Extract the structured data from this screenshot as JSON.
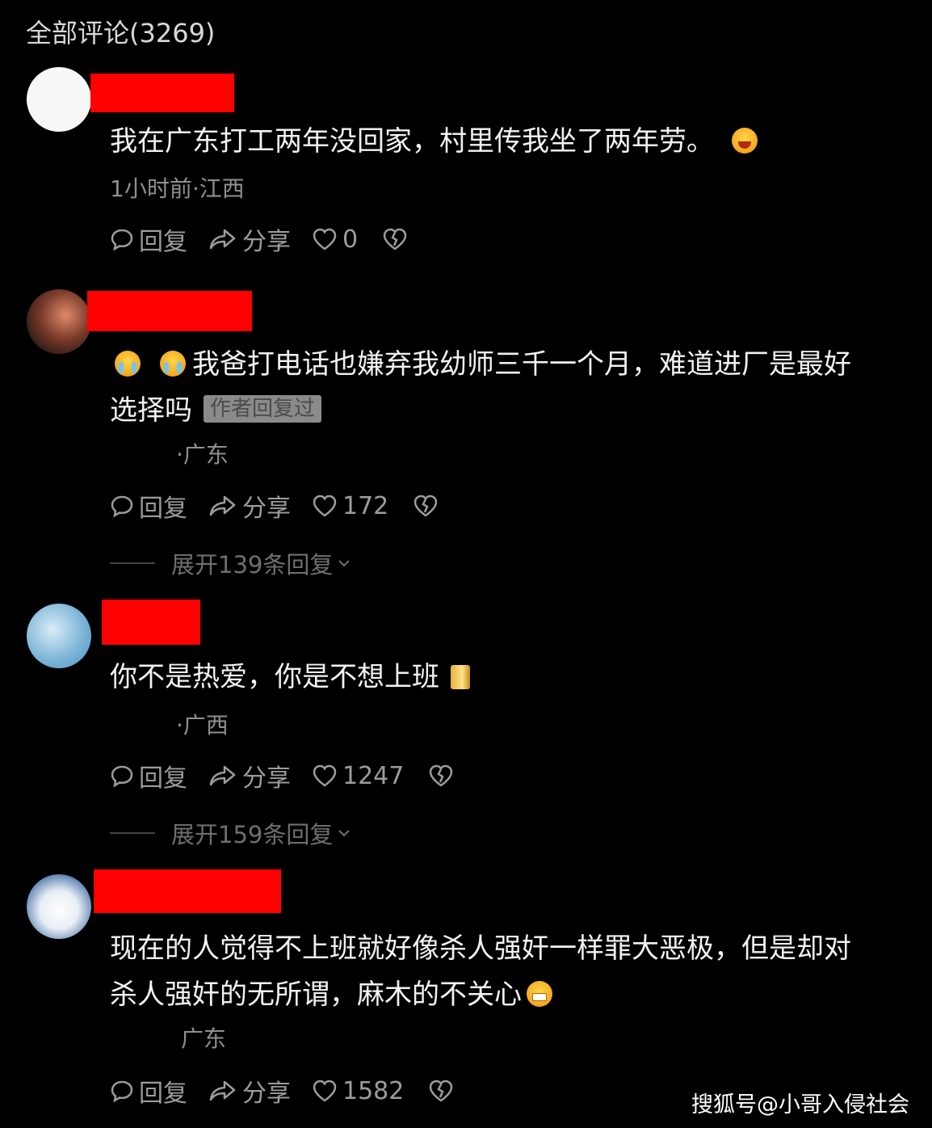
{
  "header": {
    "title": "全部评论(3269)"
  },
  "actions": {
    "reply": "回复",
    "share": "分享"
  },
  "comments": [
    {
      "text": "我在广东打工两年没回家，村里传我坐了两年劳。",
      "meta": "1小时前·江西",
      "likes": "0",
      "emoji_after": "laughing-emoji"
    },
    {
      "text_line1": "我爸打电话也嫌弃我幼师三千一个月，难道进厂是最好",
      "text_line2": "选择吗",
      "author_tag": "作者回复过",
      "meta": "·广东",
      "likes": "172",
      "expand": "展开139条回复",
      "emoji_before": [
        "crying-emoji",
        "crying-emoji"
      ]
    },
    {
      "text": "你不是热爱，你是不想上班",
      "meta": "·广西",
      "likes": "1247",
      "expand": "展开159条回复",
      "emoji_after": "gold-emoji"
    },
    {
      "text_line1": "现在的人觉得不上班就好像杀人强奸一样罪大恶极，但是却对",
      "text_line2": "杀人强奸的无所谓，麻木的不关心",
      "meta": "广东",
      "likes": "1582",
      "emoji_after": "grinning-emoji"
    }
  ],
  "watermark": "搜狐号@小哥入侵社会",
  "colors": {
    "background": "#000000",
    "redaction": "#ff0000"
  }
}
